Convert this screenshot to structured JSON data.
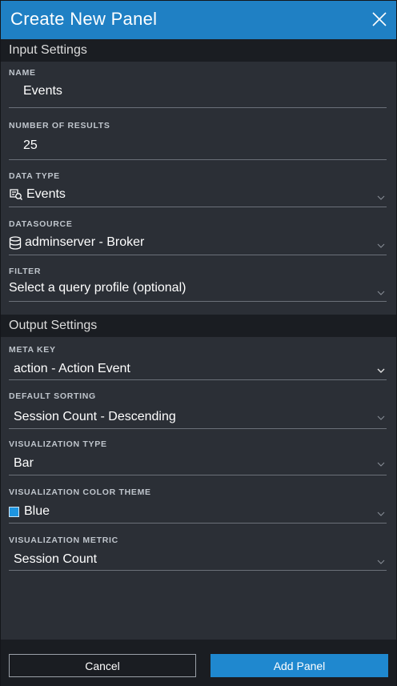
{
  "dialog": {
    "title": "Create New Panel",
    "close_icon": "close-icon"
  },
  "input_settings": {
    "heading": "Input Settings",
    "name": {
      "label": "NAME",
      "value": "Events"
    },
    "number_of_results": {
      "label": "NUMBER OF RESULTS",
      "value": "25"
    },
    "data_type": {
      "label": "DATA TYPE",
      "value": "Events",
      "icon": "events-query-icon"
    },
    "datasource": {
      "label": "DATASOURCE",
      "value": "adminserver - Broker",
      "icon": "database-icon"
    },
    "filter": {
      "label": "FILTER",
      "value": "Select a query profile (optional)"
    }
  },
  "output_settings": {
    "heading": "Output Settings",
    "meta_key": {
      "label": "META KEY",
      "value": "action - Action Event"
    },
    "default_sorting": {
      "label": "DEFAULT SORTING",
      "value": "Session Count - Descending"
    },
    "visualization_type": {
      "label": "VISUALIZATION TYPE",
      "value": "Bar"
    },
    "visualization_color_theme": {
      "label": "VISUALIZATION COLOR THEME",
      "value": "Blue",
      "swatch_color": "#1e95e0"
    },
    "visualization_metric": {
      "label": "VISUALIZATION METRIC",
      "value": "Session Count"
    }
  },
  "footer": {
    "cancel_label": "Cancel",
    "add_label": "Add Panel"
  },
  "colors": {
    "accent": "#1f80c4",
    "background": "#2b2f36",
    "section_bar": "#1a1d22"
  }
}
